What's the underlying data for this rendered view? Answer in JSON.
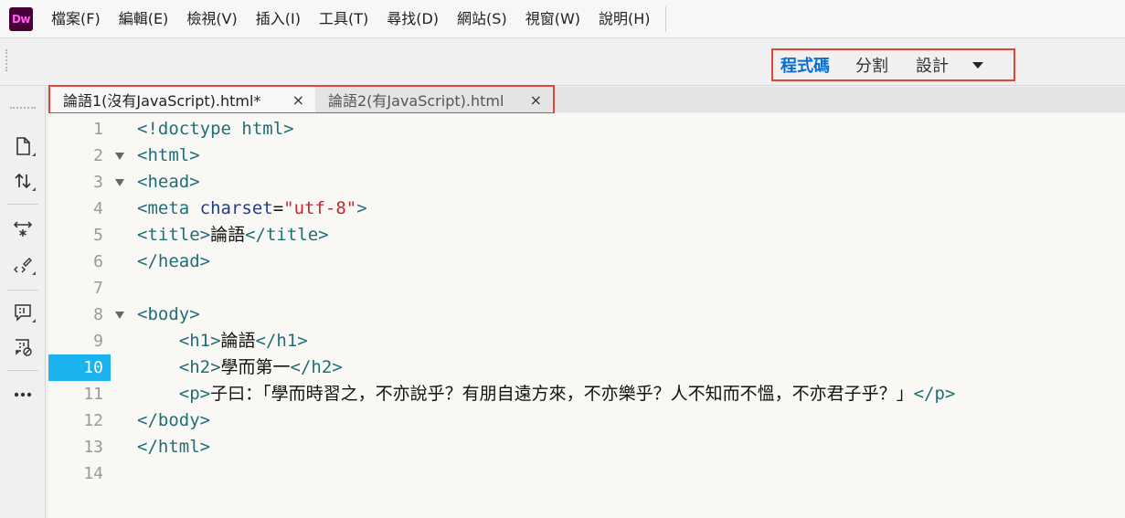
{
  "app": {
    "logo_text": "Dw",
    "brand_color": "#470137",
    "accent_color": "#ff61f6"
  },
  "menu": [
    "檔案(F)",
    "編輯(E)",
    "檢視(V)",
    "插入(I)",
    "工具(T)",
    "尋找(D)",
    "網站(S)",
    "視窗(W)",
    "說明(H)"
  ],
  "view_switcher": {
    "code": "程式碼",
    "split": "分割",
    "design": "設計",
    "active": "code"
  },
  "tabs": [
    {
      "label": "論語1(沒有JavaScript).html*",
      "active": true
    },
    {
      "label": "論語2(有JavaScript).html",
      "active": false
    }
  ],
  "tab_close_glyph": "×",
  "left_tools": [
    "new-file-icon",
    "sort-icon",
    "expand-icon",
    "code-format-icon",
    "comment-icon",
    "remove-comment-icon",
    "more-icon"
  ],
  "editor": {
    "current_line": 10,
    "lines": [
      {
        "n": "1",
        "fold": false,
        "tokens": [
          [
            "tag",
            "<!doctype html>"
          ]
        ]
      },
      {
        "n": "2",
        "fold": true,
        "tokens": [
          [
            "tag",
            "<html>"
          ]
        ]
      },
      {
        "n": "3",
        "fold": true,
        "tokens": [
          [
            "tag",
            "<head>"
          ]
        ]
      },
      {
        "n": "4",
        "fold": false,
        "tokens": [
          [
            "tag",
            "<meta "
          ],
          [
            "attr",
            "charset"
          ],
          [
            "plain",
            "="
          ],
          [
            "str",
            "\"utf-8\""
          ],
          [
            "tag",
            ">"
          ]
        ]
      },
      {
        "n": "5",
        "fold": false,
        "tokens": [
          [
            "tag",
            "<title>"
          ],
          [
            "txt",
            "論語"
          ],
          [
            "tag",
            "</title>"
          ]
        ]
      },
      {
        "n": "6",
        "fold": false,
        "tokens": [
          [
            "tag",
            "</head>"
          ]
        ]
      },
      {
        "n": "7",
        "fold": false,
        "tokens": []
      },
      {
        "n": "8",
        "fold": true,
        "tokens": [
          [
            "tag",
            "<body>"
          ]
        ]
      },
      {
        "n": "9",
        "fold": false,
        "tokens": [
          [
            "plain",
            "    "
          ],
          [
            "tag",
            "<h1>"
          ],
          [
            "txt",
            "論語"
          ],
          [
            "tag",
            "</h1>"
          ]
        ]
      },
      {
        "n": "10",
        "fold": false,
        "tokens": [
          [
            "plain",
            "    "
          ],
          [
            "tag",
            "<h2>"
          ],
          [
            "txt",
            "學而第一"
          ],
          [
            "tag",
            "</h2>"
          ]
        ]
      },
      {
        "n": "11",
        "fold": false,
        "tokens": [
          [
            "plain",
            "    "
          ],
          [
            "tag",
            "<p>"
          ],
          [
            "txt",
            "子曰：「學而時習之，不亦說乎？有朋自遠方來，不亦樂乎？人不知而不慍，不亦君子乎？」"
          ],
          [
            "tag",
            "</p>"
          ]
        ]
      },
      {
        "n": "12",
        "fold": false,
        "tokens": [
          [
            "tag",
            "</body>"
          ]
        ]
      },
      {
        "n": "13",
        "fold": false,
        "tokens": [
          [
            "tag",
            "</html>"
          ]
        ]
      },
      {
        "n": "14",
        "fold": false,
        "tokens": []
      }
    ]
  }
}
